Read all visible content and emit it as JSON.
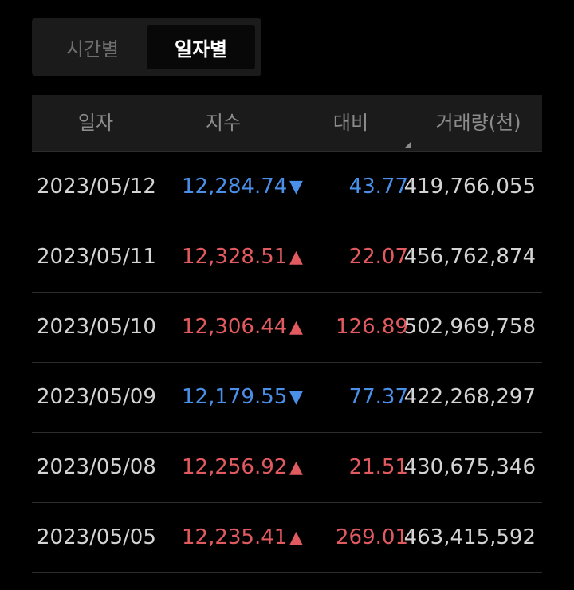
{
  "tabs": {
    "hourly_label": "시간별",
    "daily_label": "일자별",
    "selected": "일자별"
  },
  "table": {
    "headers": {
      "date": "일자",
      "index": "지수",
      "change": "대비",
      "volume": "거래량(천)"
    },
    "rows": [
      {
        "date": "2023/05/12",
        "index": "12,284.74",
        "arrow": "▼",
        "change": "43.77",
        "volume": "419,766,055",
        "direction": "down"
      },
      {
        "date": "2023/05/11",
        "index": "12,328.51",
        "arrow": "▲",
        "change": "22.07",
        "volume": "456,762,874",
        "direction": "up"
      },
      {
        "date": "2023/05/10",
        "index": "12,306.44",
        "arrow": "▲",
        "change": "126.89",
        "volume": "502,969,758",
        "direction": "up"
      },
      {
        "date": "2023/05/09",
        "index": "12,179.55",
        "arrow": "▼",
        "change": "77.37",
        "volume": "422,268,297",
        "direction": "down"
      },
      {
        "date": "2023/05/08",
        "index": "12,256.92",
        "arrow": "▲",
        "change": "21.51",
        "volume": "430,675,346",
        "direction": "up"
      },
      {
        "date": "2023/05/05",
        "index": "12,235.41",
        "arrow": "▲",
        "change": "269.01",
        "volume": "463,415,592",
        "direction": "up"
      }
    ]
  },
  "icons": {
    "sort": "sort-corner-icon",
    "up": "triangle-up-icon",
    "down": "triangle-down-icon"
  },
  "colors": {
    "background": "#000000",
    "panel": "#1b1b1b",
    "up": "#e05a5f",
    "down": "#4a8fe8",
    "text": "#d4d4d4",
    "muted": "#8c8c8c"
  }
}
